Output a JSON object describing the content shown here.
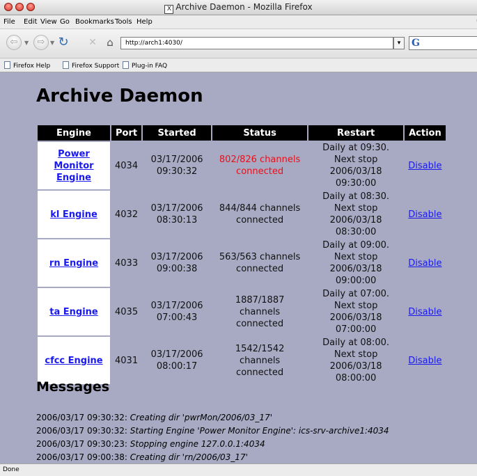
{
  "window": {
    "title": "Archive Daemon - Mozilla Firefox"
  },
  "menu": [
    "File",
    "Edit",
    "View",
    "Go",
    "Bookmarks",
    "Tools",
    "Help"
  ],
  "nav": {
    "url": "http://arch1:4030/",
    "search_value": ""
  },
  "bookmarks": [
    "Firefox Help",
    "Firefox Support",
    "Plug-in FAQ"
  ],
  "page": {
    "title": "Archive Daemon",
    "headers": [
      "Engine",
      "Port",
      "Started",
      "Status",
      "Restart",
      "Action"
    ],
    "rows": [
      {
        "engine": [
          "Power Monitor",
          "Engine"
        ],
        "port": "4034",
        "started": [
          "03/17/2006",
          "09:30:32"
        ],
        "status": [
          "802/826 channels",
          "connected"
        ],
        "status_color": "#e8101a",
        "restart": [
          "Daily at 09:30.",
          "Next stop",
          "2006/03/18 09:30:00"
        ],
        "action": "Disable"
      },
      {
        "engine": [
          "kl Engine"
        ],
        "port": "4032",
        "started": [
          "03/17/2006",
          "08:30:13"
        ],
        "status": [
          "844/844 channels",
          "connected"
        ],
        "status_color": "#111111",
        "restart": [
          "Daily at 08:30.",
          "Next stop",
          "2006/03/18 08:30:00"
        ],
        "action": "Disable"
      },
      {
        "engine": [
          "rn Engine"
        ],
        "port": "4033",
        "started": [
          "03/17/2006",
          "09:00:38"
        ],
        "status": [
          "563/563 channels",
          "connected"
        ],
        "status_color": "#111111",
        "restart": [
          "Daily at 09:00.",
          "Next stop",
          "2006/03/18 09:00:00"
        ],
        "action": "Disable"
      },
      {
        "engine": [
          "ta Engine"
        ],
        "port": "4035",
        "started": [
          "03/17/2006",
          "07:00:43"
        ],
        "status": [
          "1887/1887 channels",
          "connected"
        ],
        "status_color": "#111111",
        "restart": [
          "Daily at 07:00.",
          "Next stop",
          "2006/03/18 07:00:00"
        ],
        "action": "Disable"
      },
      {
        "engine": [
          "cfcc Engine"
        ],
        "port": "4031",
        "started": [
          "03/17/2006",
          "08:00:17"
        ],
        "status": [
          "1542/1542 channels",
          "connected"
        ],
        "status_color": "#111111",
        "restart": [
          "Daily at 08:00.",
          "Next stop",
          "2006/03/18 08:00:00"
        ],
        "action": "Disable"
      }
    ],
    "messages_title": "Messages",
    "messages": [
      {
        "time": "2006/03/17 09:30:32:",
        "text": "Creating dir 'pwrMon/2006/03_17'"
      },
      {
        "time": "2006/03/17 09:30:32:",
        "text": "Starting Engine 'Power Monitor Engine': ics-srv-archive1:4034"
      },
      {
        "time": "2006/03/17 09:30:23:",
        "text": "Stopping engine 127.0.0.1:4034"
      },
      {
        "time": "2006/03/17 09:00:38:",
        "text": "Creating dir 'rn/2006/03_17'"
      }
    ]
  },
  "status_bar": "Done"
}
